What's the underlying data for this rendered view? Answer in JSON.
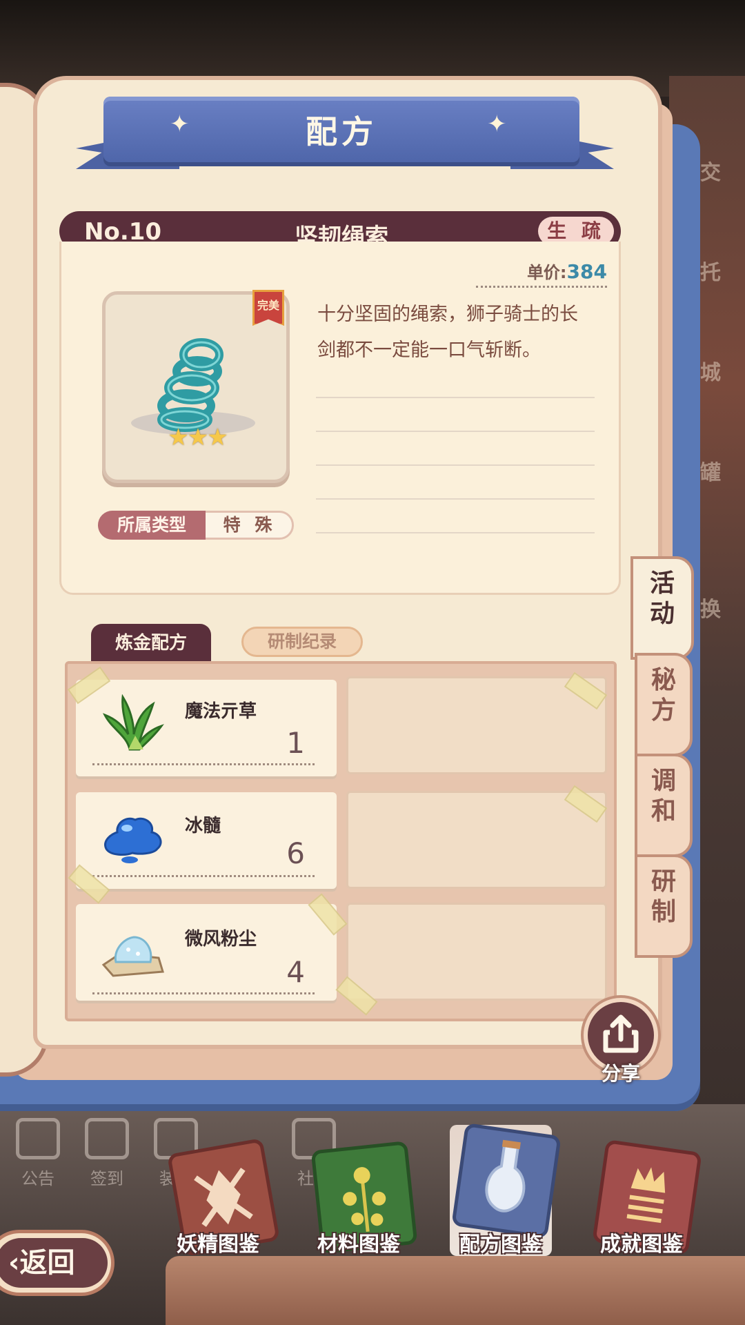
{
  "banner": {
    "title": "配方"
  },
  "header": {
    "number": "No.10",
    "name": "坚韧绳索",
    "tag": "生 疏"
  },
  "item": {
    "price_label": "单价:",
    "price_value": "384",
    "quality_badge": "完美",
    "stars": "★★★",
    "description": "十分坚固的绳索，狮子骑士的长剑都不一定能一口气斩断。",
    "type_label": "所属类型",
    "type_value": "特 殊",
    "icon": "rope-icon"
  },
  "tabs": {
    "active": "炼金配方",
    "inactive": "研制纪录"
  },
  "ingredients": [
    {
      "name": "魔法亓草",
      "qty": "1",
      "icon": "herb-icon"
    },
    {
      "name": "冰髓",
      "qty": "6",
      "icon": "ice-slime-icon"
    },
    {
      "name": "微风粉尘",
      "qty": "4",
      "icon": "dust-icon"
    }
  ],
  "side_tabs": [
    "活\n动",
    "秘\n方",
    "调\n和",
    "研\n制"
  ],
  "share": {
    "label": "分享"
  },
  "bottom_nav": [
    {
      "label": "妖精图鉴",
      "icon": "fairy-book-icon"
    },
    {
      "label": "材料图鉴",
      "icon": "material-book-icon"
    },
    {
      "label": "配方图鉴",
      "icon": "recipe-book-icon",
      "active": true
    },
    {
      "label": "成就图鉴",
      "icon": "achievement-book-icon"
    }
  ],
  "back": {
    "label": "返回"
  },
  "background_labels": {
    "right": [
      "交",
      "托",
      "城",
      "罐",
      "换"
    ],
    "nav": [
      "公告",
      "签到",
      "装饰",
      "社区"
    ]
  },
  "colors": {
    "header": "#5a2f3b",
    "cover": "#5a79b6",
    "page": "#f6ead3",
    "price": "#3c8aa8"
  }
}
